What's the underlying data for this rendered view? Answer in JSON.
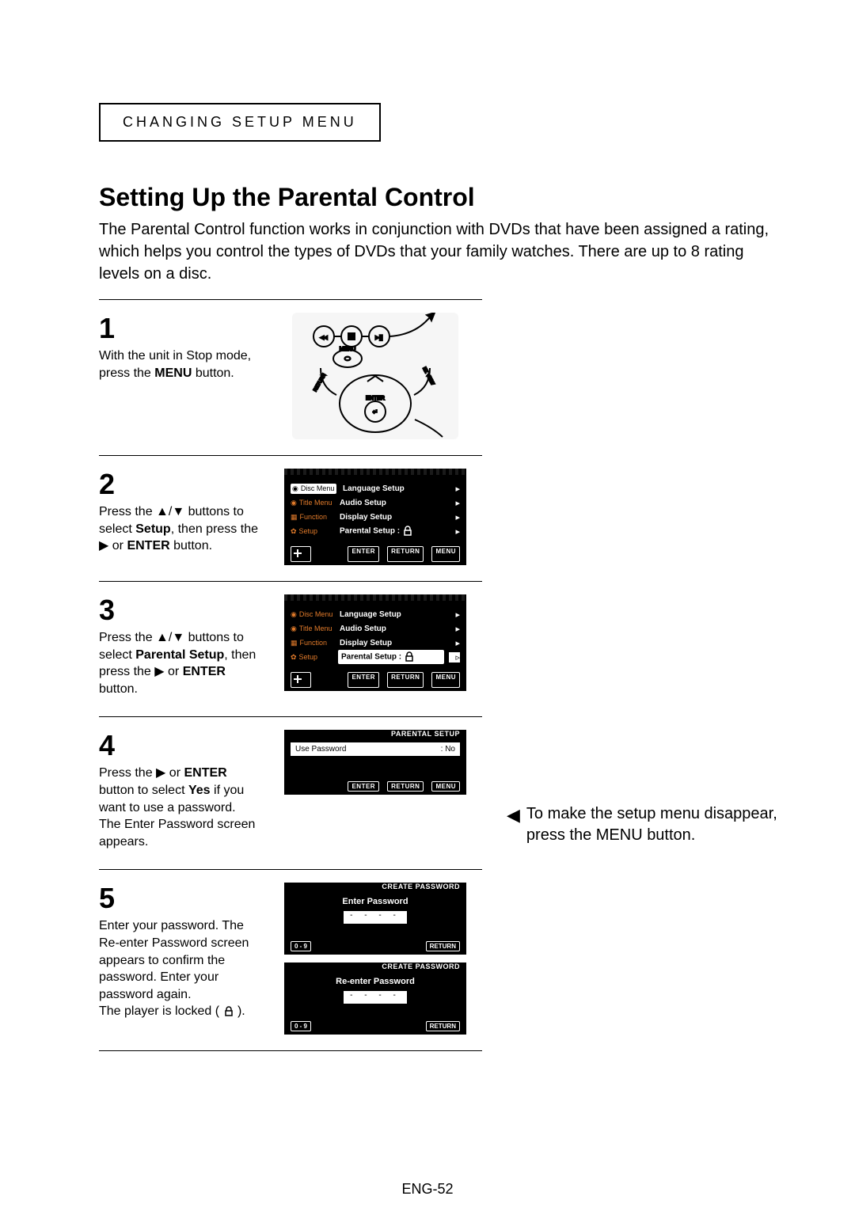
{
  "section_tag": "CHANGING SETUP MENU",
  "heading": "Setting Up the Parental Control",
  "intro": "The Parental Control function works in conjunction with DVDs that have been assigned a rating, which helps you control the types of DVDs that your family watches. There are up to 8 rating levels on a disc.",
  "steps": {
    "s1": {
      "num": "1",
      "pre": "With the unit in Stop mode, press the ",
      "bold": "MENU",
      "post": " button."
    },
    "s2": {
      "num": "2",
      "a": "Press the ",
      "b": " buttons to select ",
      "c": "Setup",
      "d": ", then press the ",
      "e": " or ",
      "f": "ENTER",
      "g": " button."
    },
    "s3": {
      "num": "3",
      "a": "Press the ",
      "b": " buttons to select ",
      "c": "Parental Setup",
      "d": ", then press the ",
      "e": " or ",
      "f": "ENTER",
      "g": " button."
    },
    "s4": {
      "num": "4",
      "a": "Press the ",
      "b": " or ",
      "c": "ENTER",
      "d": " button to select ",
      "e": "Yes",
      "f": " if you want to use a password. The Enter Password screen appears."
    },
    "s5": {
      "num": "5",
      "text": "Enter your password. The Re-enter Password screen appears to confirm the password. Enter your password again.",
      "locked": "The player is locked ( "
    }
  },
  "osd_menu": {
    "left": {
      "l0": "Disc Menu",
      "l1": "Title Menu",
      "l2": "Function",
      "l3": "Setup"
    },
    "items": {
      "i0": "Language Setup",
      "i1": "Audio Setup",
      "i2": "Display Setup",
      "i3": "Parental Setup :"
    },
    "footer": {
      "enter": "ENTER",
      "return": "RETURN",
      "menu": "MENU"
    }
  },
  "parental_screen": {
    "title": "PARENTAL SETUP",
    "row_label": "Use Password",
    "row_value": ": No"
  },
  "create_pw": {
    "title": "CREATE PASSWORD",
    "enter": "Enter Password",
    "reenter": "Re-enter Password",
    "digits": "0 - 9",
    "return": "RETURN"
  },
  "remote_labels": {
    "menu": "MENU",
    "enter": "ENTER",
    "return": "RETURN",
    "ezview": "EZ VIEW"
  },
  "note": "To make the setup menu disappear, press the MENU button.",
  "page_number": "ENG-52"
}
